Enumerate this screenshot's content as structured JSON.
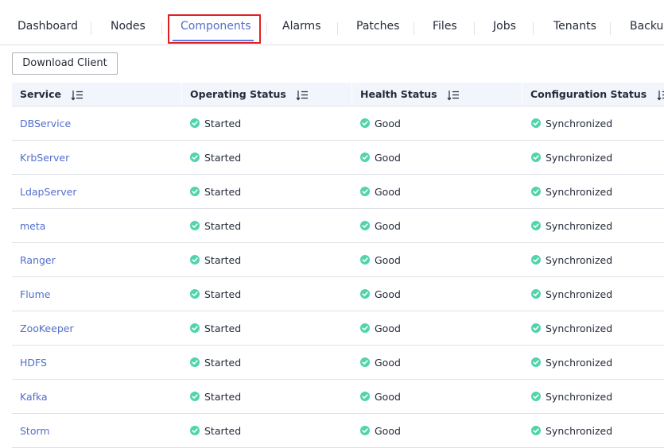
{
  "tabs": [
    {
      "label": "Dashboard",
      "active": false
    },
    {
      "label": "Nodes",
      "active": false
    },
    {
      "label": "Components",
      "active": true
    },
    {
      "label": "Alarms",
      "active": false
    },
    {
      "label": "Patches",
      "active": false
    },
    {
      "label": "Files",
      "active": false
    },
    {
      "label": "Jobs",
      "active": false
    },
    {
      "label": "Tenants",
      "active": false
    },
    {
      "label": "Backup",
      "active": false
    }
  ],
  "toolbar": {
    "download_client_label": "Download Client"
  },
  "table": {
    "columns": [
      "Service",
      "Operating Status",
      "Health Status",
      "Configuration Status"
    ],
    "rows": [
      {
        "service": "DBService",
        "operating": "Started",
        "health": "Good",
        "config": "Synchronized"
      },
      {
        "service": "KrbServer",
        "operating": "Started",
        "health": "Good",
        "config": "Synchronized"
      },
      {
        "service": "LdapServer",
        "operating": "Started",
        "health": "Good",
        "config": "Synchronized"
      },
      {
        "service": "meta",
        "operating": "Started",
        "health": "Good",
        "config": "Synchronized"
      },
      {
        "service": "Ranger",
        "operating": "Started",
        "health": "Good",
        "config": "Synchronized"
      },
      {
        "service": "Flume",
        "operating": "Started",
        "health": "Good",
        "config": "Synchronized"
      },
      {
        "service": "ZooKeeper",
        "operating": "Started",
        "health": "Good",
        "config": "Synchronized"
      },
      {
        "service": "HDFS",
        "operating": "Started",
        "health": "Good",
        "config": "Synchronized"
      },
      {
        "service": "Kafka",
        "operating": "Started",
        "health": "Good",
        "config": "Synchronized"
      },
      {
        "service": "Storm",
        "operating": "Started",
        "health": "Good",
        "config": "Synchronized"
      }
    ]
  },
  "colors": {
    "accent": "#526ecc",
    "status_ok": "#50d4ab",
    "highlight": "#e02020"
  }
}
